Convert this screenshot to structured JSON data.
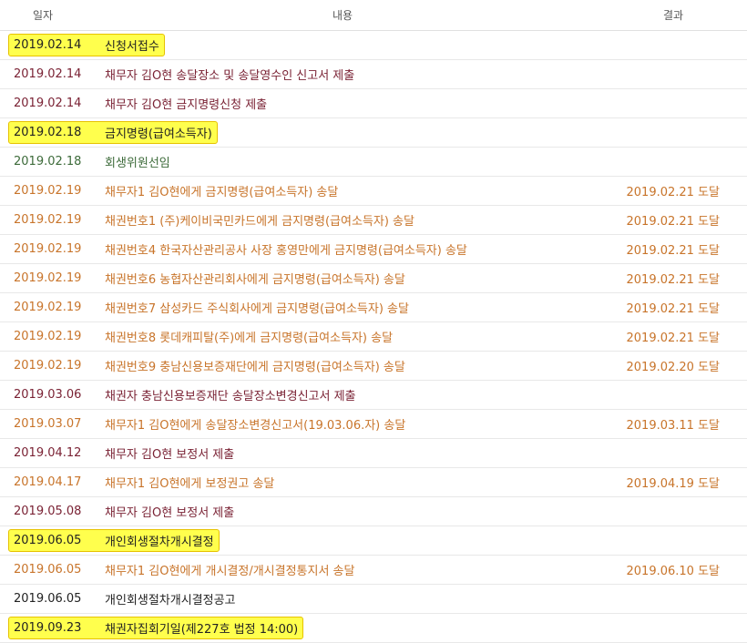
{
  "header": {
    "date": "일자",
    "content": "내용",
    "result": "결과"
  },
  "colors": {
    "black": "#222222",
    "maroon": "#7a2234",
    "green": "#3d6b3a",
    "orange": "#c8742a",
    "highlight": "#ffff4d"
  },
  "rows": [
    {
      "date": "2019.02.14",
      "text": "신청서접수",
      "result": "",
      "color": "black",
      "highlight": true
    },
    {
      "date": "2019.02.14",
      "text": "채무자 김O현 송달장소 및 송달영수인 신고서 제출",
      "result": "",
      "color": "maroon",
      "highlight": false
    },
    {
      "date": "2019.02.14",
      "text": "채무자 김O현 금지명령신청 제출",
      "result": "",
      "color": "maroon",
      "highlight": false
    },
    {
      "date": "2019.02.18",
      "text": "금지명령(급여소득자)",
      "result": "",
      "color": "black",
      "highlight": true
    },
    {
      "date": "2019.02.18",
      "text": "회생위원선임",
      "result": "",
      "color": "green",
      "highlight": false
    },
    {
      "date": "2019.02.19",
      "text": "채무자1 김O현에게 금지명령(급여소득자) 송달",
      "result": "2019.02.21 도달",
      "color": "orange",
      "highlight": false
    },
    {
      "date": "2019.02.19",
      "text": "채권번호1 (주)케이비국민카드에게 금지명령(급여소득자) 송달",
      "result": "2019.02.21 도달",
      "color": "orange",
      "highlight": false
    },
    {
      "date": "2019.02.19",
      "text": "채권번호4 한국자산관리공사 사장 홍영만에게 금지명령(급여소득자) 송달",
      "result": "2019.02.21 도달",
      "color": "orange",
      "highlight": false
    },
    {
      "date": "2019.02.19",
      "text": "채권번호6 농협자산관리회사에게 금지명령(급여소득자) 송달",
      "result": "2019.02.21 도달",
      "color": "orange",
      "highlight": false
    },
    {
      "date": "2019.02.19",
      "text": "채권번호7 삼성카드 주식회사에게 금지명령(급여소득자) 송달",
      "result": "2019.02.21 도달",
      "color": "orange",
      "highlight": false
    },
    {
      "date": "2019.02.19",
      "text": "채권번호8 롯데캐피탈(주)에게 금지명령(급여소득자) 송달",
      "result": "2019.02.21 도달",
      "color": "orange",
      "highlight": false
    },
    {
      "date": "2019.02.19",
      "text": "채권번호9 충남신용보증재단에게 금지명령(급여소득자) 송달",
      "result": "2019.02.20 도달",
      "color": "orange",
      "highlight": false
    },
    {
      "date": "2019.03.06",
      "text": "채권자 충남신용보증재단 송달장소변경신고서 제출",
      "result": "",
      "color": "maroon",
      "highlight": false
    },
    {
      "date": "2019.03.07",
      "text": "채무자1 김O현에게 송달장소변경신고서(19.03.06.자) 송달",
      "result": "2019.03.11 도달",
      "color": "orange",
      "highlight": false
    },
    {
      "date": "2019.04.12",
      "text": "채무자 김O현 보정서 제출",
      "result": "",
      "color": "maroon",
      "highlight": false
    },
    {
      "date": "2019.04.17",
      "text": "채무자1 김O현에게 보정권고 송달",
      "result": "2019.04.19 도달",
      "color": "orange",
      "highlight": false
    },
    {
      "date": "2019.05.08",
      "text": "채무자 김O현 보정서 제출",
      "result": "",
      "color": "maroon",
      "highlight": false
    },
    {
      "date": "2019.06.05",
      "text": "개인회생절차개시결정",
      "result": "",
      "color": "black",
      "highlight": true
    },
    {
      "date": "2019.06.05",
      "text": "채무자1 김O현에게 개시결정/개시결정통지서 송달",
      "result": "2019.06.10 도달",
      "color": "orange",
      "highlight": false
    },
    {
      "date": "2019.06.05",
      "text": "개인회생절차개시결정공고",
      "result": "",
      "color": "black",
      "highlight": false
    },
    {
      "date": "2019.09.23",
      "text": "채권자집회기일(제227호 법정 14:00)",
      "result": "",
      "color": "black",
      "highlight": true
    }
  ]
}
